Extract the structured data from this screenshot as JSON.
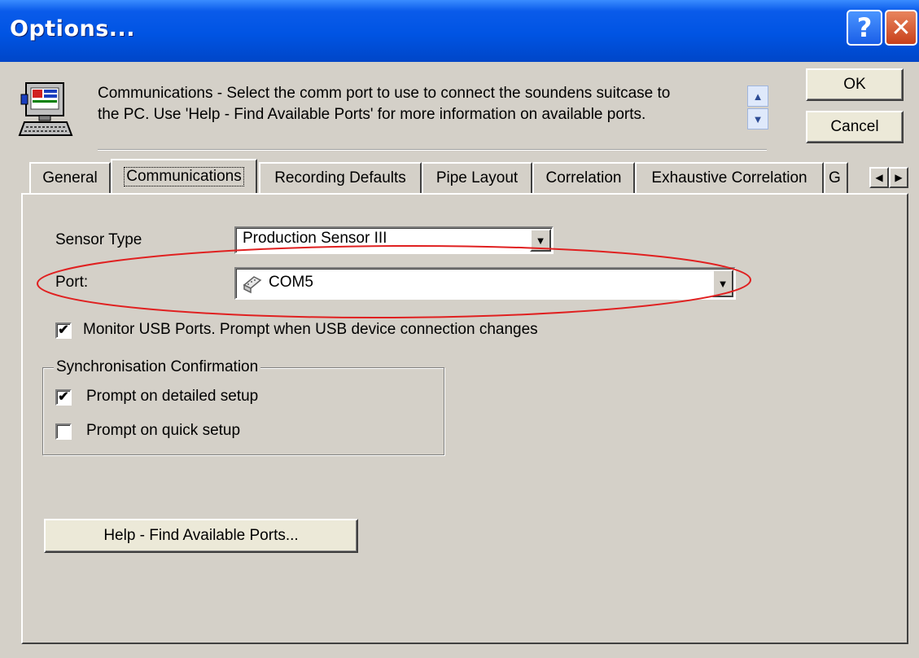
{
  "window": {
    "title": "Options...",
    "help_glyph": "?",
    "close_glyph": "✕"
  },
  "header": {
    "description_line1": "Communications - Select the comm port to use to connect the soundens suitcase to",
    "description_line2": "the PC. Use 'Help - Find Available Ports' for more information on available ports.",
    "icon": "computer-config-icon"
  },
  "buttons": {
    "ok": "OK",
    "cancel": "Cancel",
    "help_find_ports": "Help - Find Available Ports..."
  },
  "tabs": [
    {
      "label": "General"
    },
    {
      "label": "Communications"
    },
    {
      "label": "Recording Defaults"
    },
    {
      "label": "Pipe Layout"
    },
    {
      "label": "Correlation"
    },
    {
      "label": "Exhaustive Correlation"
    },
    {
      "label": "G"
    }
  ],
  "communications": {
    "sensor_type_label": "Sensor Type",
    "sensor_type_value": "Production Sensor III",
    "port_label": "Port:",
    "port_value": "COM5",
    "monitor_usb_label": "Monitor USB Ports. Prompt when USB device connection changes",
    "monitor_usb_checked": true,
    "sync_group_title": "Synchronisation Confirmation",
    "prompt_detailed_label": "Prompt on detailed setup",
    "prompt_detailed_checked": true,
    "prompt_quick_label": "Prompt on quick setup",
    "prompt_quick_checked": false
  },
  "annotation": {
    "highlight_color": "#e02020"
  },
  "icons": {
    "checkmark": "✔",
    "dropdown": "▼",
    "scroll_up": "▲",
    "scroll_down": "▼",
    "tab_left": "◀",
    "tab_right": "▶"
  }
}
